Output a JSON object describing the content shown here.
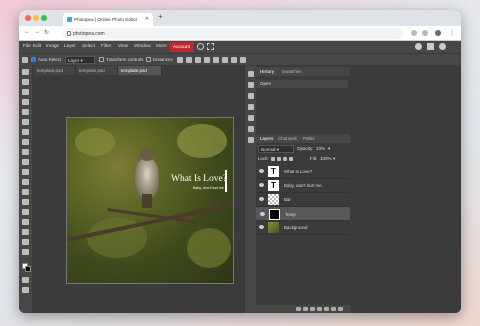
{
  "browser": {
    "tab_title": "Photopea | Online Photo Editor",
    "url": "photopea.com"
  },
  "menu": [
    "File",
    "Edit",
    "Image",
    "Layer",
    "Select",
    "Filter",
    "View",
    "Window",
    "More",
    "Account"
  ],
  "options": {
    "auto_select": "Auto-Select",
    "layer_select": "Layer",
    "transform_controls": "Transform controls",
    "distances": "Distances"
  },
  "doc_tabs": [
    "template.psd",
    "template.psd",
    "template.psd"
  ],
  "image": {
    "title": "What Is Love?",
    "subtitle": "Baby, don't hurt me"
  },
  "history": {
    "tabs": [
      "History",
      "Swatches"
    ],
    "items": [
      "Open"
    ]
  },
  "layers_panel": {
    "tabs": [
      "Layers",
      "Channels",
      "Paths"
    ],
    "blend_mode": "Normal",
    "opacity_label": "Opacity:",
    "opacity": "23%",
    "lock_label": "Lock:",
    "fill_label": "Fill:",
    "fill": "100%",
    "layers": [
      {
        "name": "What Is Love?",
        "type": "text"
      },
      {
        "name": "Baby, don't hurt me.",
        "type": "text"
      },
      {
        "name": "Bar",
        "type": "shape"
      },
      {
        "name": "Temp",
        "type": "fill"
      },
      {
        "name": "Background",
        "type": "image"
      }
    ]
  },
  "text_glyph": "T",
  "colors": {
    "accent": "#c0262b",
    "selection": "#2b82d9"
  }
}
